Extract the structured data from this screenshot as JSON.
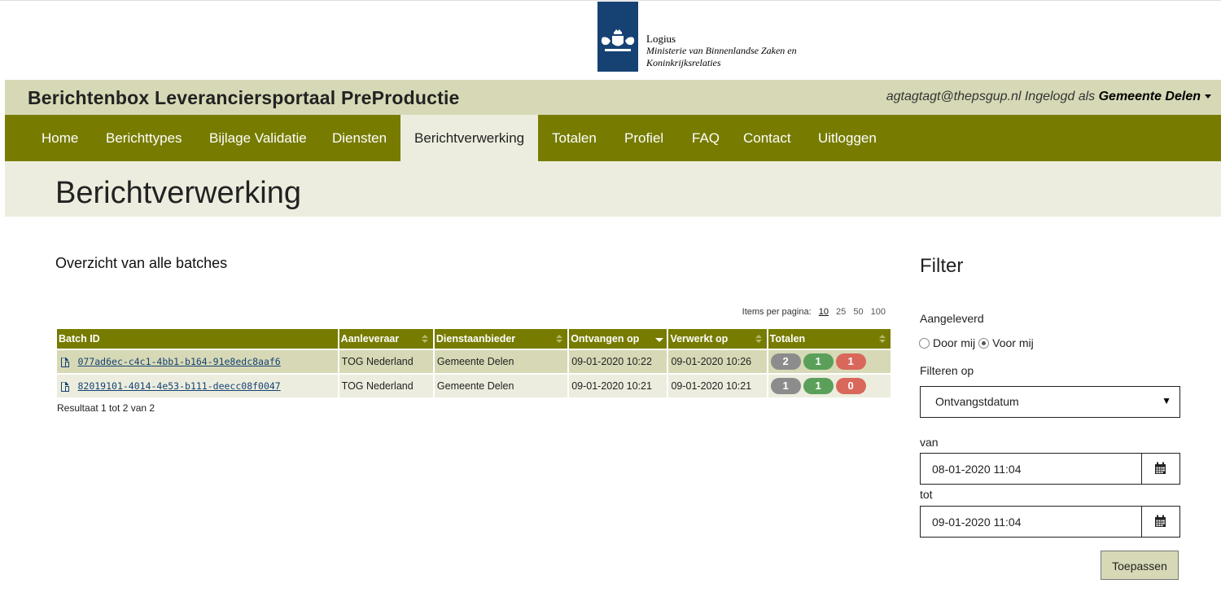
{
  "logo": {
    "name": "Logius",
    "ministry_line1": "Ministerie van Binnenlandse Zaken en",
    "ministry_line2": "Koninkrijksrelaties"
  },
  "header": {
    "site_title": "Berichtenbox Leveranciersportaal PreProductie",
    "user_email": "agtagtagt@thepsgup.nl",
    "logged_in_as": "Ingelogd als",
    "organisation": "Gemeente Delen"
  },
  "nav": {
    "items": [
      "Home",
      "Berichttypes",
      "Bijlage Validatie",
      "Diensten",
      "Berichtverwerking",
      "Totalen",
      "Profiel",
      "FAQ",
      "Contact",
      "Uitloggen"
    ],
    "active": "Berichtverwerking"
  },
  "page": {
    "title": "Berichtverwerking",
    "overview_title": "Overzicht van alle batches"
  },
  "pagination": {
    "label": "Items per pagina:",
    "options": [
      "10",
      "25",
      "50",
      "100"
    ],
    "current": "10"
  },
  "table": {
    "columns": [
      "Batch ID",
      "Aanleveraar",
      "Dienstaanbieder",
      "Ontvangen op",
      "Verwerkt op",
      "Totalen"
    ],
    "rows": [
      {
        "batch_id": "077ad6ec-c4c1-4bb1-b164-91e8edc8aaf6",
        "aanleveraar": "TOG Nederland",
        "dienstaanbieder": "Gemeente Delen",
        "ontvangen_op": "09-01-2020 10:22",
        "verwerkt_op": "09-01-2020 10:26",
        "totalen": [
          "2",
          "1",
          "1"
        ]
      },
      {
        "batch_id": "82019101-4014-4e53-b111-deecc08f0047",
        "aanleveraar": "TOG Nederland",
        "dienstaanbieder": "Gemeente Delen",
        "ontvangen_op": "09-01-2020 10:21",
        "verwerkt_op": "09-01-2020 10:21",
        "totalen": [
          "1",
          "1",
          "0"
        ]
      }
    ],
    "result_text": "Resultaat 1 tot 2 van 2"
  },
  "filter": {
    "title": "Filter",
    "aangeleverd_label": "Aangeleverd",
    "radio_door_mij": "Door mij",
    "radio_voor_mij": "Voor mij",
    "radio_selected": "Voor mij",
    "filteren_op_label": "Filteren op",
    "filteren_op_value": "Ontvangstdatum",
    "van_label": "van",
    "van_value": "08-01-2020 11:04",
    "tot_label": "tot",
    "tot_value": "09-01-2020 11:04",
    "apply_label": "Toepassen"
  },
  "colors": {
    "nav_bg": "#777c00",
    "title_bar_bg": "#d7d9b6",
    "page_header_bg": "#ecedde",
    "logo_blue": "#154273",
    "pill_grey": "#8c8c8c",
    "pill_green": "#5aa05a",
    "pill_red": "#d9675b"
  }
}
